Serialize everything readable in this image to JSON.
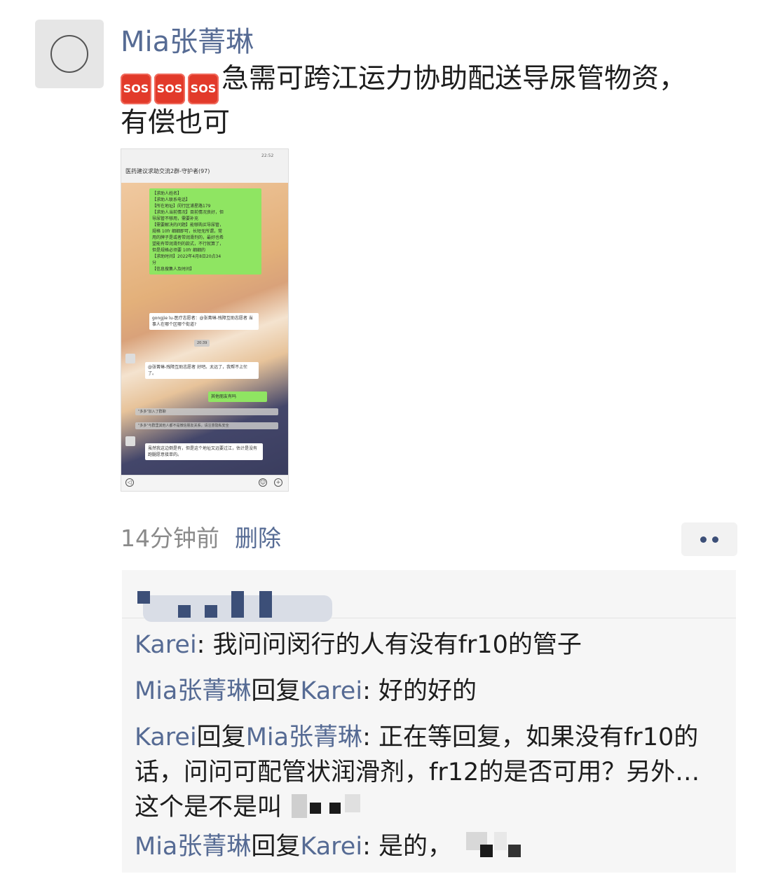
{
  "post": {
    "author": "Mia张菁琳",
    "sos_label": "SOS",
    "text_line1": "急需可跨江运力协助配送导尿管物资，",
    "text_line2": "有偿也可",
    "time": "14分钟前",
    "delete_label": "删除"
  },
  "screenshot": {
    "title": "医药建议求助交流2群-守护者(97)",
    "status_time": "22:52",
    "request_lines": [
      "【求助人姓名】",
      "【求助人联系电话】",
      "【所在地址】闵行区浦星路179",
      "【求助人当前情况】目前情况良好，但",
      "导尿管不够用，需要补充",
      "【需要解决的问题】能够购买导尿管，",
      "规格 10fr 细细即可，长短无所谓，常",
      "用的牌子是或者带润滑剂的，最好也希",
      "望能有带润滑剂的款式，不行就算了，",
      "但是规格必须要 10fr 细细的",
      "【求助时间】2022年4月8日20点34",
      "分",
      "【信息搜集人及时间】"
    ],
    "reply1": "gongjie lu-医疗志愿者：@张菁琳-残障互助志愿者 当事人在哪个区哪个街道?",
    "time_marker": "20:39",
    "reply2": "@张菁琳-残障互助志愿者 好吧。太远了，我帮不上忙了。",
    "green2": "其他朋友有吗",
    "sys1": "\"多多\"加入了群聊",
    "sys2": "\"多多\"与群里其他人都不是微信朋友关系，请注意隐私安全",
    "reply3_name": "gongjie lu-医疗志愿者",
    "reply3": "虽然我这边倒是有，但是这个地址又远要过江，估计是没有跑腿愿意接单的。"
  },
  "comments": [
    {
      "from": "Karei",
      "to": "",
      "reply_word": "",
      "text": "我问问闵行的人有没有fr10的管子"
    },
    {
      "from": "Mia张菁琳",
      "to": "Karei",
      "reply_word": "回复",
      "text": "好的好的"
    },
    {
      "from": "Karei",
      "to": "Mia张菁琳",
      "reply_word": "回复",
      "text": "正在等回复，如果没有fr10的话，问问可配管状润滑剂，fr12的是否可用？另外…这个是不是叫"
    },
    {
      "from": "Mia张菁琳",
      "to": "Karei",
      "reply_word": "回复",
      "text": "是的，"
    }
  ],
  "colors": {
    "link": "#566b94",
    "accent_dark": "#3c4f78",
    "sos_red": "#e23a2a",
    "chat_green": "#8fe562"
  },
  "icons": [
    "avatar-placeholder-icon",
    "sos-icon",
    "more-dots-icon",
    "voice-icon",
    "emoji-icon",
    "plus-icon"
  ]
}
